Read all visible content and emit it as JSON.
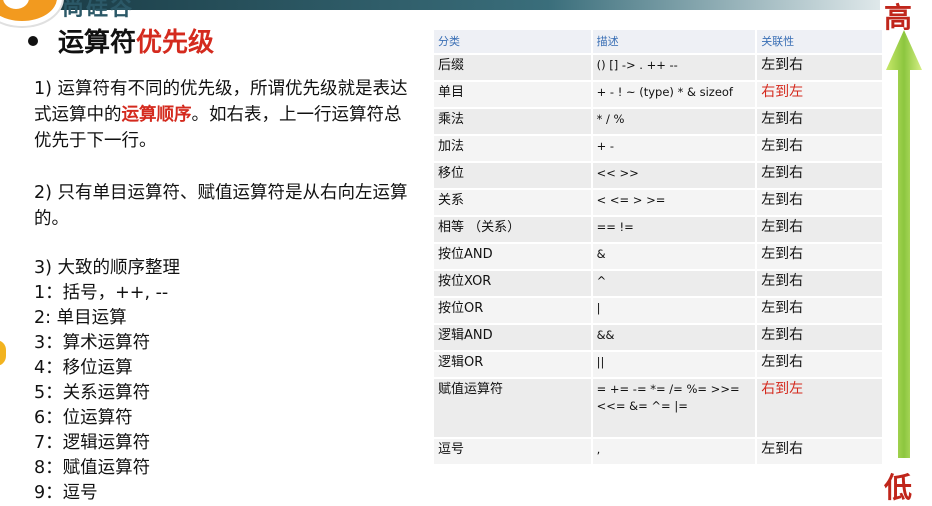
{
  "header": {
    "brand_text": "尚硅谷"
  },
  "title": {
    "main": "运算符",
    "highlight": "优先级"
  },
  "paragraphs": {
    "p1_a": "1) 运算符有不同的优先级，所谓优先级就是表达式运算中的",
    "p1_red": "运算顺序",
    "p1_b": "。如右表，上一行运算符总优先于下一行。",
    "p2": "2) 只有单目运算符、赋值运算符是从右向左运算的。",
    "p3": "3) 大致的顺序整理"
  },
  "order_list": [
    "1：括号，++, --",
    "2:  单目运算",
    "3：算术运算符",
    "4：移位运算",
    "5：关系运算符",
    "6：位运算符",
    "7：逻辑运算符",
    "8：赋值运算符",
    "9：逗号"
  ],
  "table": {
    "headers": [
      "分类",
      "描述",
      "关联性"
    ],
    "rows": [
      {
        "category": "后缀",
        "desc": "() [] -> . ++ --",
        "assoc": "左到右",
        "assoc_red": false
      },
      {
        "category": "单目",
        "desc": "+ - ! ~  (type) * & sizeof",
        "assoc": "右到左",
        "assoc_red": true
      },
      {
        "category": "乘法",
        "desc": "* / %",
        "assoc": "左到右",
        "assoc_red": false
      },
      {
        "category": "加法",
        "desc": "+ -",
        "assoc": "左到右",
        "assoc_red": false
      },
      {
        "category": "移位",
        "desc": "<< >>",
        "assoc": "左到右",
        "assoc_red": false
      },
      {
        "category": "关系",
        "desc": "< <= > >=",
        "assoc": "左到右",
        "assoc_red": false
      },
      {
        "category": "相等 （关系）",
        "desc": "== !=",
        "assoc": "左到右",
        "assoc_red": false
      },
      {
        "category": "按位AND",
        "desc": "&",
        "assoc": "左到右",
        "assoc_red": false
      },
      {
        "category": "按位XOR",
        "desc": "^",
        "assoc": "左到右",
        "assoc_red": false
      },
      {
        "category": "按位OR",
        "desc": "|",
        "assoc": "左到右",
        "assoc_red": false
      },
      {
        "category": "逻辑AND",
        "desc": "&&",
        "assoc": "左到右",
        "assoc_red": false
      },
      {
        "category": "逻辑OR",
        "desc": "||",
        "assoc": "左到右",
        "assoc_red": false
      },
      {
        "category": "赋值运算符",
        "desc": "= += -= *= /= %= >>= <<= &= ^= |=",
        "assoc": "右到左",
        "assoc_red": true
      },
      {
        "category": "逗号",
        "desc": ",",
        "assoc": "左到右",
        "assoc_red": false
      }
    ]
  },
  "arrow": {
    "top_label": "高",
    "bottom_label": "低",
    "color": "#9acd32"
  },
  "colors": {
    "accent_red": "#d42a1e",
    "header_blue": "#3a6fb5"
  }
}
